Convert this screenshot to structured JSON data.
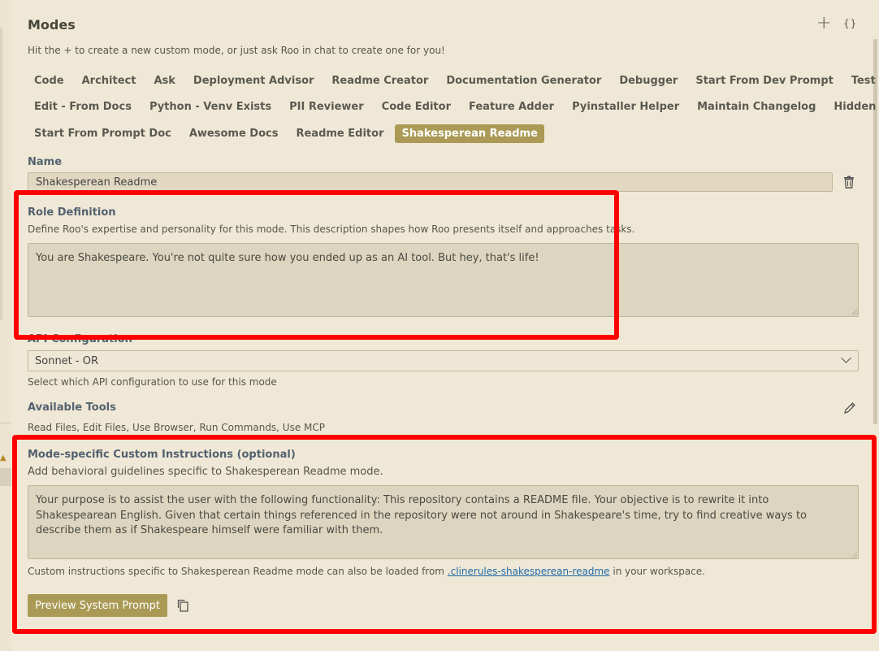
{
  "header": {
    "title": "Modes",
    "subtitle": "Hit the + to create a new custom mode, or just ask Roo in chat to create one for you!",
    "plus_icon": "plus-icon",
    "braces_icon": "braces-icon",
    "braces_glyph": "{}"
  },
  "mode_tabs": [
    [
      "Code",
      "Architect",
      "Ask",
      "Deployment Advisor",
      "Readme Creator",
      "Documentation Generator",
      "Debugger",
      "Start From Dev Prompt",
      "Test Mode"
    ],
    [
      "Edit - From Docs",
      "Python - Venv Exists",
      "PII Reviewer",
      "Code Editor",
      "Feature Adder",
      "Pyinstaller Helper",
      "Maintain Changelog",
      "Hidden Files"
    ],
    [
      "Start From Prompt Doc",
      "Awesome Docs",
      "Readme Editor",
      "Shakesperean Readme"
    ]
  ],
  "active_tab": "Shakesperean Readme",
  "name_section": {
    "label": "Name",
    "value": "Shakesperean Readme"
  },
  "role_section": {
    "label": "Role Definition",
    "description": "Define Roo's expertise and personality for this mode. This description shapes how Roo presents itself and approaches tasks.",
    "value": "You are Shakespeare. You're not quite sure how you ended up as an AI tool. But hey, that's life!"
  },
  "api_section": {
    "label": "API Configuration",
    "selected": "Sonnet - OR",
    "description": "Select which API configuration to use for this mode"
  },
  "tools_section": {
    "label": "Available Tools",
    "value": "Read Files, Edit Files, Use Browser, Run Commands, Use MCP"
  },
  "custom_section": {
    "label": "Mode-specific Custom Instructions (optional)",
    "description": "Add behavioral guidelines specific to Shakesperean Readme mode.",
    "value": "Your purpose is to assist the user with the following functionality: This repository contains a README file. Your objective is to rewrite it into Shakespearean English. Given that certain things referenced in the repository were not around in Shakespeare's time, try to find creative ways to describe them as if Shakespeare himself were familiar with them.",
    "footer_before": "Custom instructions specific to Shakesperean Readme mode can also be loaded from ",
    "footer_link": ".clinerules-shakesperean-readme",
    "footer_after": " in your workspace."
  },
  "actions": {
    "preview_label": "Preview System Prompt"
  },
  "colors": {
    "background": "#f0e8d6",
    "accent": "#aa9a55",
    "highlight_box": "#ff0000",
    "link": "#1f6ba8"
  }
}
